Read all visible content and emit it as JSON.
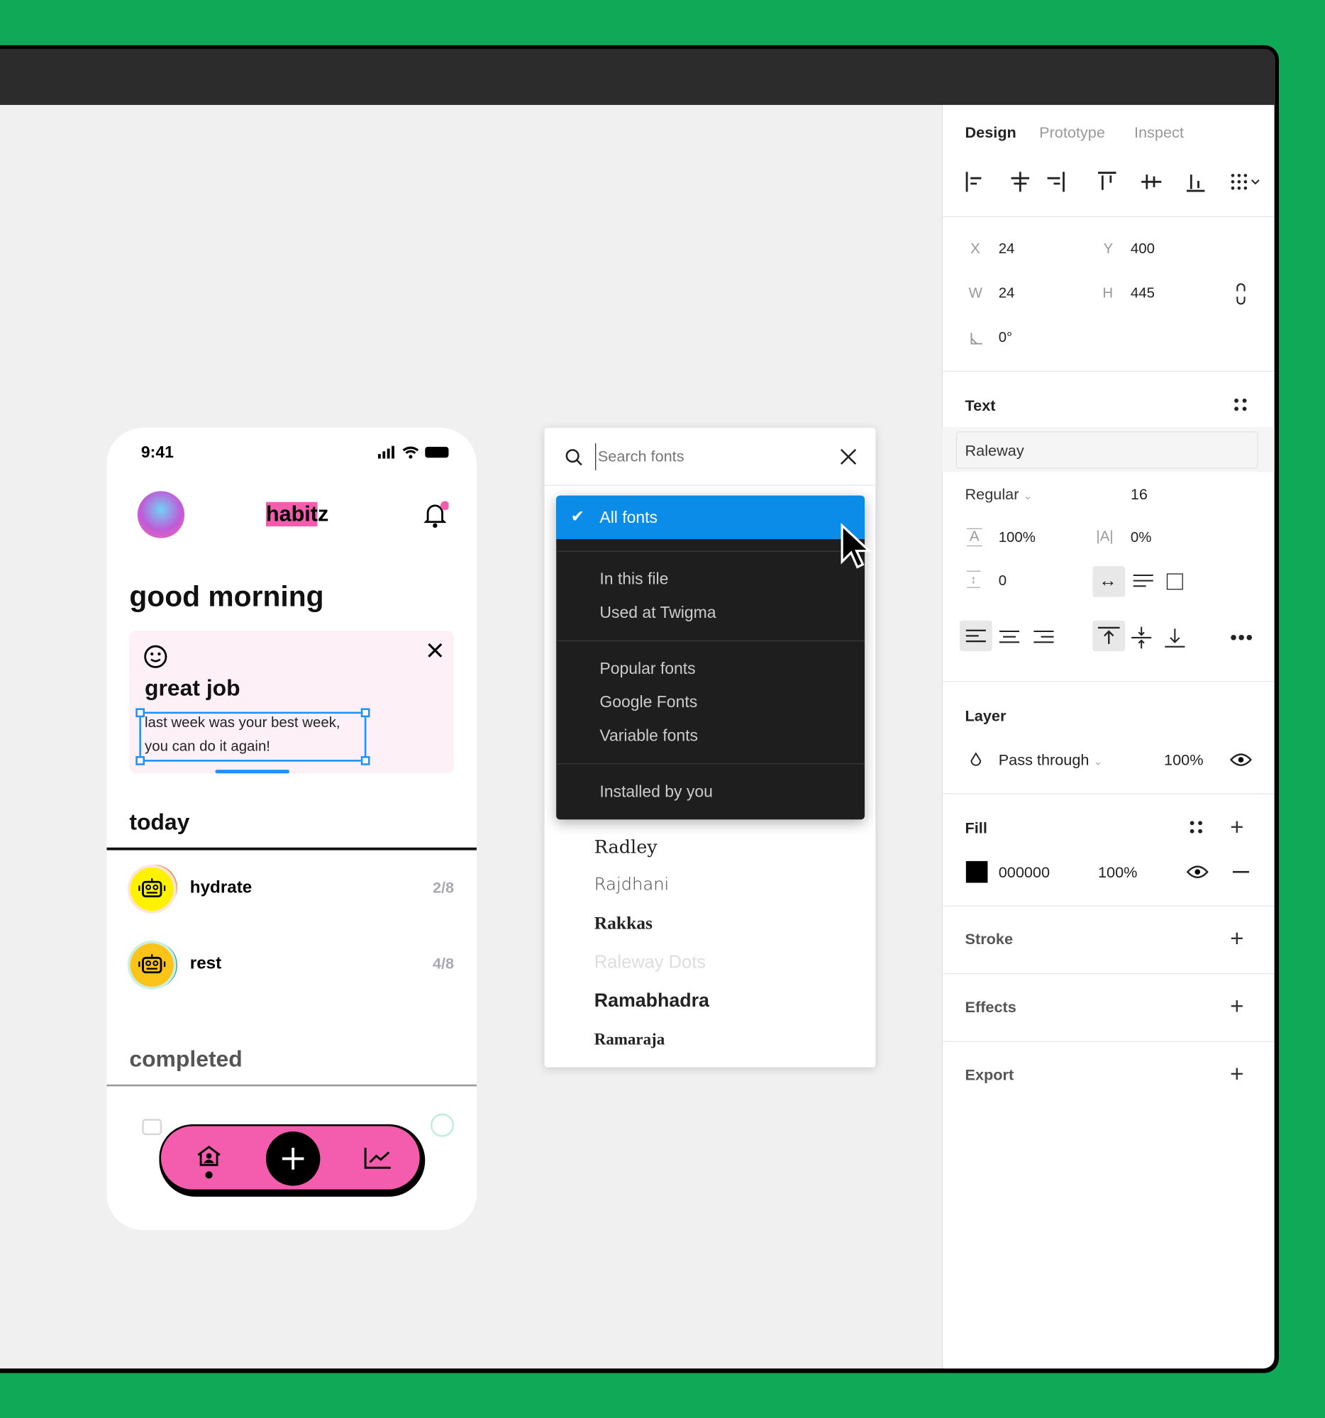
{
  "colors": {
    "background": "#10a957",
    "accent": "#1e90ff",
    "brand_pink": "#f45dae"
  },
  "phone": {
    "time": "9:41",
    "logo_highlight": "habit",
    "logo_rest": "z",
    "greeting": "good morning",
    "card": {
      "title": "great job",
      "body_line1": "last week was your best week,",
      "body_line2": "you can do it again!"
    },
    "today_label": "today",
    "habits": [
      {
        "name": "hydrate",
        "progress": "2/8"
      },
      {
        "name": "rest",
        "progress": "4/8"
      }
    ],
    "completed_label": "completed",
    "icons": [
      "avatar",
      "bell-icon",
      "smiley-icon",
      "close-icon",
      "robot-icon",
      "home-icon",
      "plus-icon",
      "chart-icon"
    ]
  },
  "fonts": {
    "search_placeholder": "Search fonts",
    "menu": {
      "selected": "All fonts",
      "group1": [
        "In this file",
        "Used at Twigma"
      ],
      "group2": [
        "Popular fonts",
        "Google Fonts",
        "Variable fonts"
      ],
      "group3": [
        "Installed by you"
      ]
    },
    "list": [
      "Radley",
      "Rajdhani",
      "Rakkas",
      "Raleway Dots",
      "Ramabhadra",
      "Ramaraja"
    ]
  },
  "panel": {
    "tabs": [
      "Design",
      "Prototype",
      "Inspect"
    ],
    "x_label": "X",
    "x": "24",
    "y_label": "Y",
    "y": "400",
    "w_label": "W",
    "w": "24",
    "h_label": "H",
    "h": "445",
    "rotation": "0°",
    "text_section": "Text",
    "font_family": "Raleway",
    "font_style": "Regular",
    "font_size": "16",
    "line_height": "100%",
    "letter_spacing": "0%",
    "paragraph_spacing": "0",
    "layer_section": "Layer",
    "blend_mode": "Pass through",
    "layer_opacity": "100%",
    "fill_section": "Fill",
    "fill_hex": "000000",
    "fill_opacity": "100%",
    "fill_color": "#000000",
    "stroke_section": "Stroke",
    "effects_section": "Effects",
    "export_section": "Export"
  }
}
